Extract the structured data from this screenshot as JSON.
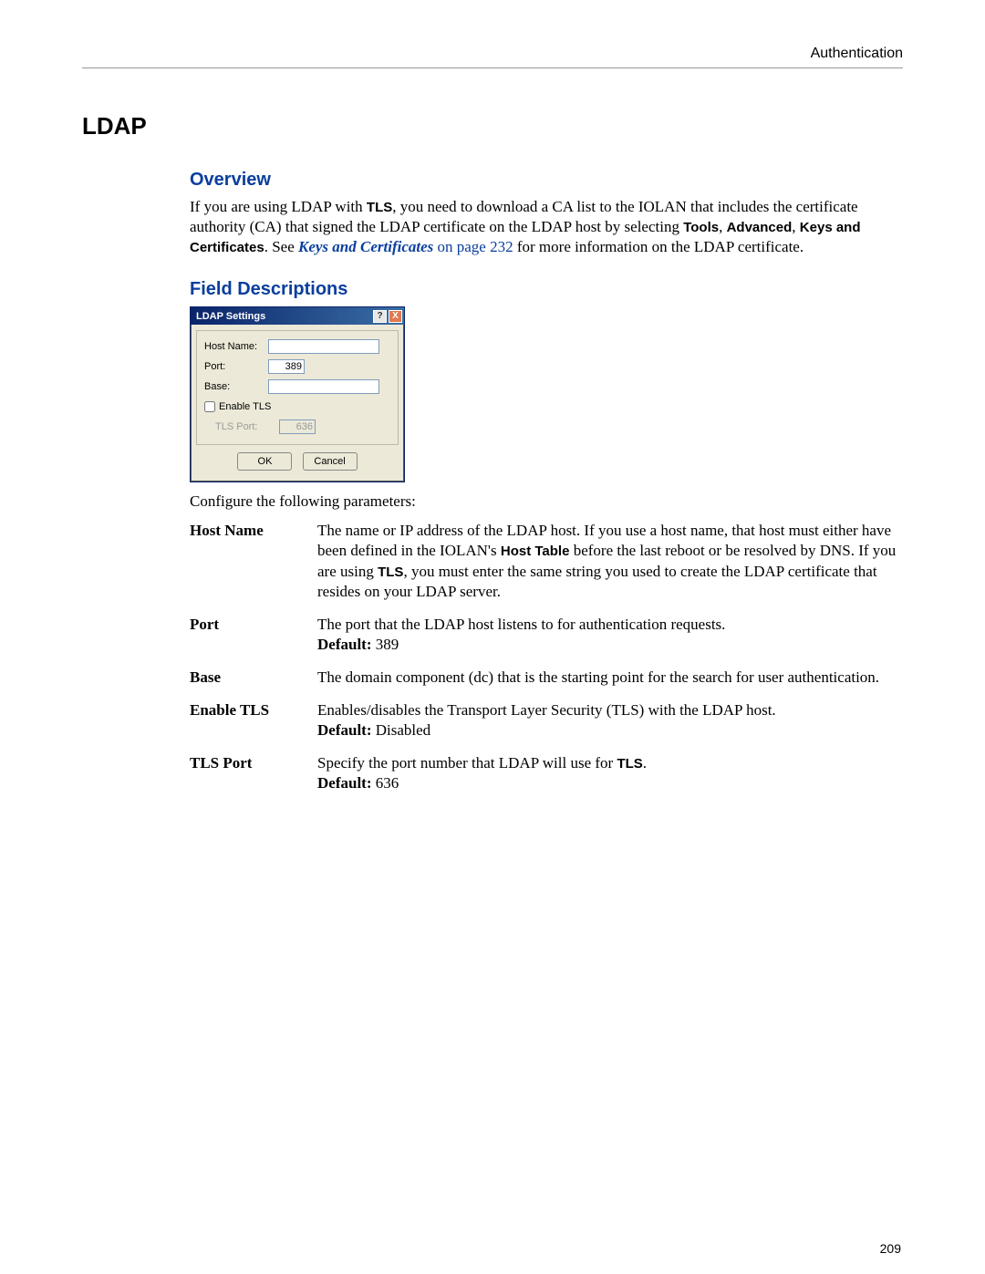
{
  "header": {
    "breadcrumb": "Authentication"
  },
  "title": "LDAP",
  "overview": {
    "heading": "Overview",
    "text_pre": "If you are using LDAP with ",
    "tls": "TLS",
    "text_mid1": ", you need to download a CA list to the IOLAN that includes the certificate authority (CA) that signed the LDAP certificate on the LDAP host by selecting ",
    "tools": "Tools",
    "sep1": ", ",
    "advanced": "Advanced",
    "sep2": ", ",
    "keys_cert": "Keys and Certificates",
    "text_mid2": ". See ",
    "link_text": "Keys and Certificates",
    "link_page": " on page 232",
    "text_end": " for more information on the LDAP certificate."
  },
  "field_desc": {
    "heading": "Field Descriptions",
    "intro": "Configure the following parameters:"
  },
  "dialog": {
    "title": "LDAP Settings",
    "labels": {
      "host": "Host Name:",
      "port": "Port:",
      "base": "Base:",
      "enable_tls": "Enable TLS",
      "tls_port": "TLS Port:"
    },
    "values": {
      "host": "",
      "port": "389",
      "base": "",
      "tls_port": "636"
    },
    "buttons": {
      "ok": "OK",
      "cancel": "Cancel"
    }
  },
  "fields": [
    {
      "name": "Host Name",
      "desc_pre": "The name or IP address of the LDAP host. If you use a host name, that host must either have been defined in the IOLAN's ",
      "bold1": "Host Table",
      "desc_mid1": " before the last reboot or be resolved by DNS. If you are using ",
      "bold2": "TLS",
      "desc_post": ", you must enter the same string you used to create the LDAP certificate that resides on your LDAP server."
    },
    {
      "name": "Port",
      "desc": "The port that the LDAP host listens to for authentication requests.",
      "default_label": "Default:",
      "default_value": " 389"
    },
    {
      "name": "Base",
      "desc": "The domain component (dc) that is the starting point for the search for user authentication."
    },
    {
      "name": "Enable TLS",
      "desc": "Enables/disables the Transport Layer Security (TLS) with the LDAP host.",
      "default_label": "Default:",
      "default_value": " Disabled"
    },
    {
      "name": "TLS Port",
      "desc_pre": "Specify the port number that LDAP will use for ",
      "bold1": "TLS",
      "desc_post": ".",
      "default_label": "Default:",
      "default_value": " 636"
    }
  ],
  "page_number": "209"
}
